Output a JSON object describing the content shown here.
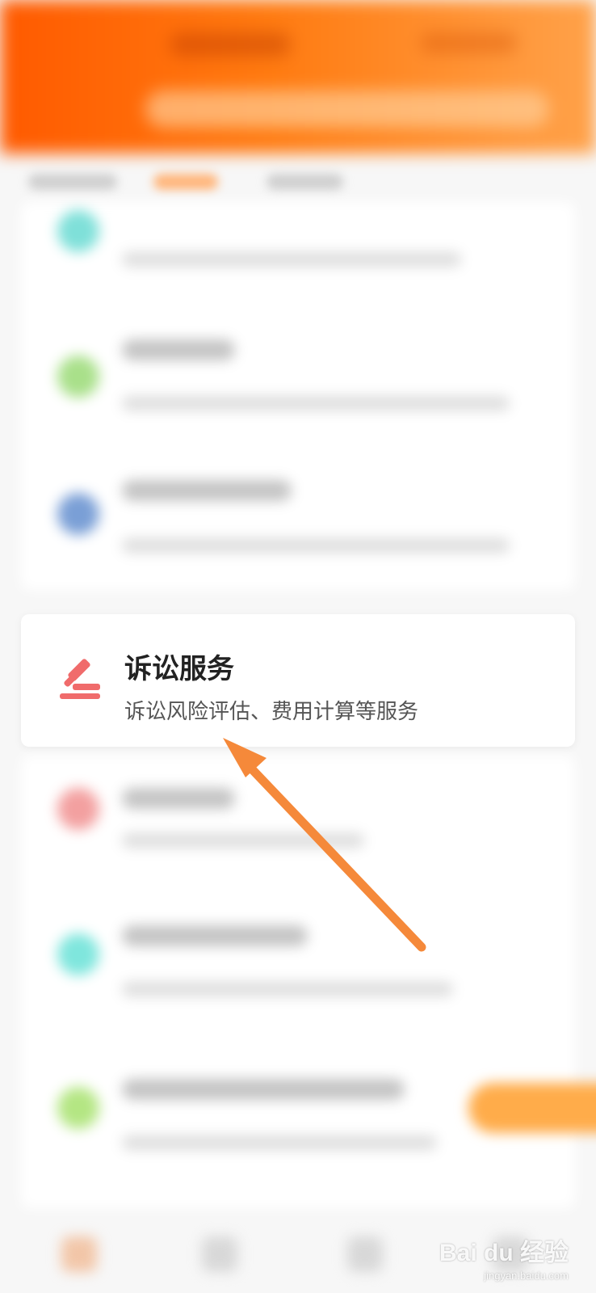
{
  "service": {
    "title": "诉讼服务",
    "description": "诉讼风险评估、费用计算等服务",
    "icon": "gavel-icon",
    "icon_color": "#f06b6b"
  },
  "header": {
    "color": "#ff6a00"
  },
  "annotation": {
    "type": "arrow",
    "color": "#f5893a"
  },
  "watermark": {
    "brand": "Bai du 经验",
    "url": "jingyan.baidu.com"
  }
}
